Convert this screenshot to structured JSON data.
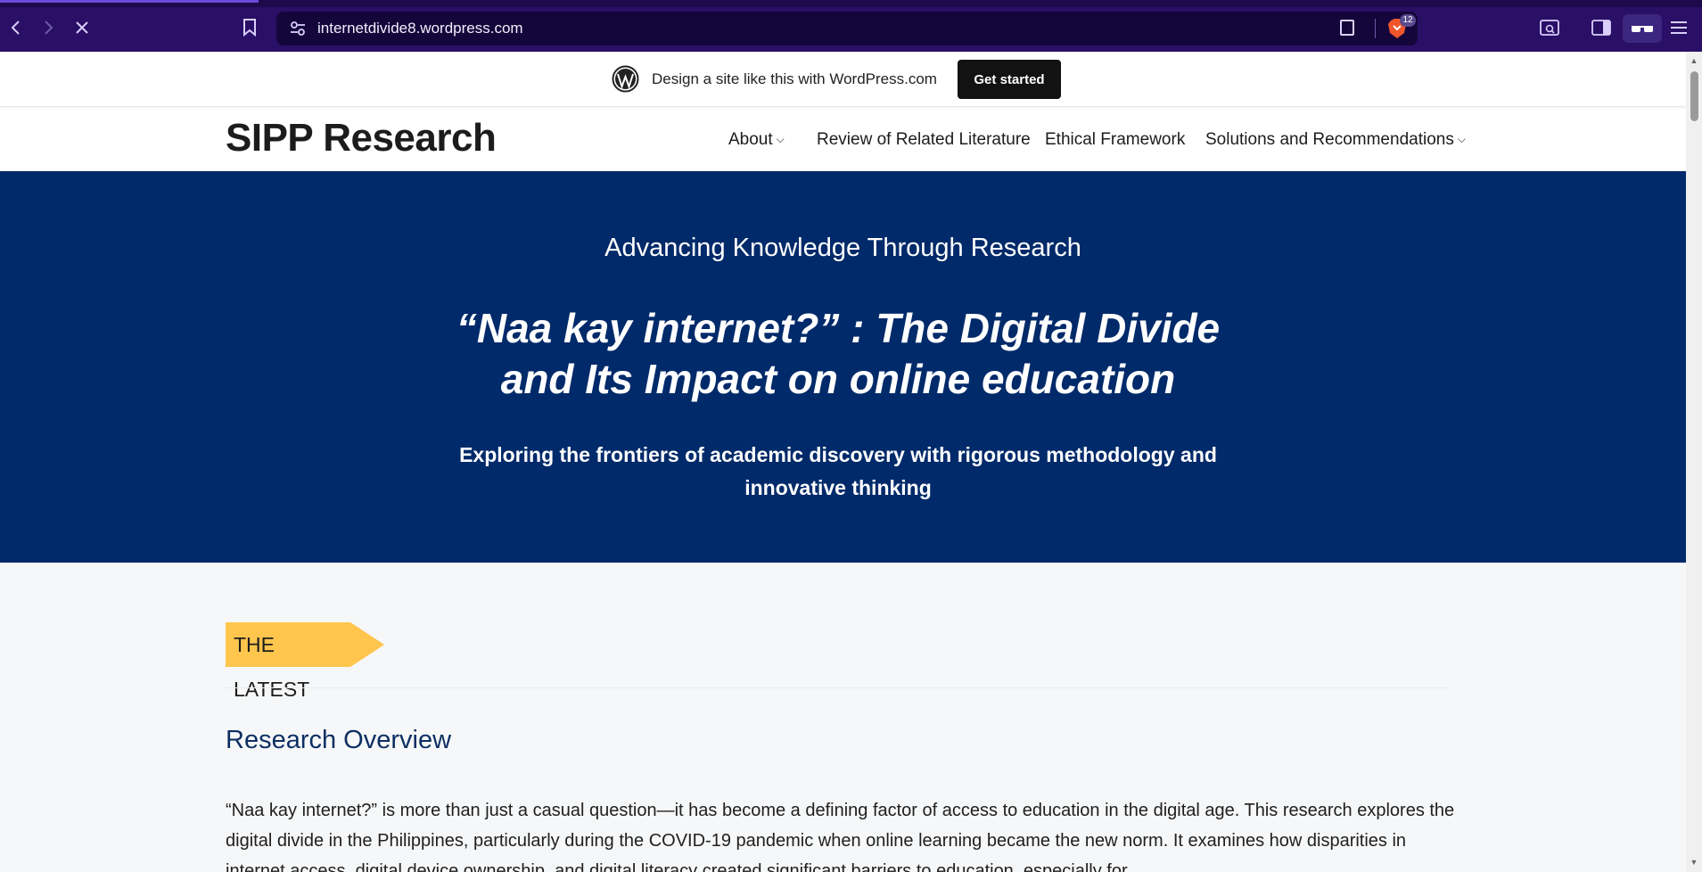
{
  "browser": {
    "url": "internetdivide8.wordpress.com",
    "shields_count": "12",
    "icons": {
      "back": "chevron-left-icon",
      "forward": "chevron-right-icon",
      "stop": "close-icon",
      "bookmark": "bookmark-icon",
      "site_info": "tune-icon",
      "reader": "reader-mode-icon",
      "shields": "brave-shields-icon",
      "tab_search": "tab-search-icon",
      "sidebar": "sidebar-icon",
      "private": "glasses-icon",
      "menu": "hamburger-menu-icon"
    },
    "colors": {
      "chrome_bg": "#2a0f66",
      "urlbar_bg": "#14063a"
    }
  },
  "wp_banner": {
    "text": "Design a site like this with WordPress.com",
    "button": "Get started"
  },
  "site": {
    "title": "SIPP Research",
    "nav": [
      {
        "label": "About",
        "has_submenu": true
      },
      {
        "label": "Review of Related Literature",
        "has_submenu": false
      },
      {
        "label": "Ethical Framework",
        "has_submenu": false
      },
      {
        "label": "Solutions and Recommendations",
        "has_submenu": true
      }
    ]
  },
  "hero": {
    "kicker": "Advancing Knowledge Through Research",
    "headline": "“Naa kay internet?” : The Digital Divide and Its Impact on online education",
    "subtitle": "Exploring the frontiers of academic discovery with rigorous methodology and innovative thinking",
    "bg_color": "#002a6a"
  },
  "latest": {
    "tag": "THE LATEST",
    "tag_color": "#ffc54d"
  },
  "overview": {
    "title": "Research Overview",
    "body": "“Naa kay internet?” is more than just a casual question—it has become a defining factor of access to education in the digital age. This research explores the digital divide in the Philippines, particularly during the COVID-19 pandemic when online learning became the new norm. It examines how disparities in internet access, digital device ownership, and digital literacy created significant barriers to education, especially for"
  }
}
